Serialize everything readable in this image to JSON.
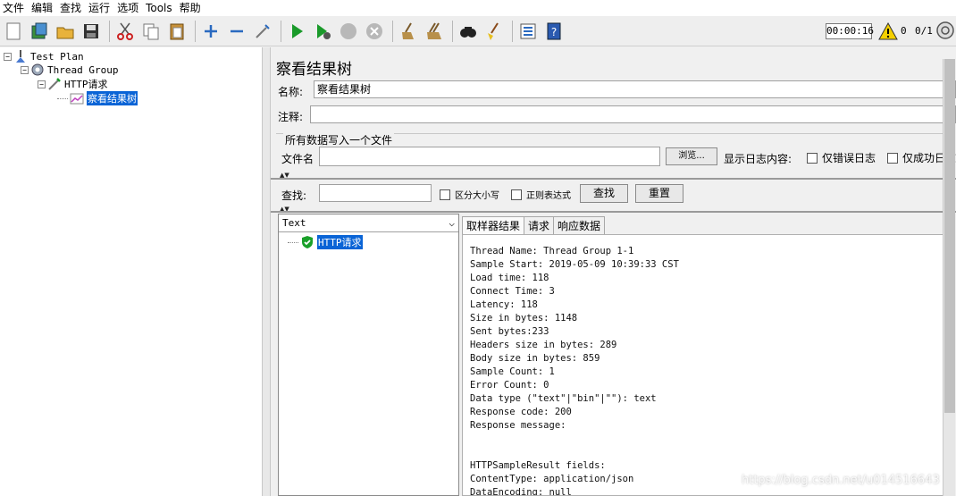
{
  "menu": [
    "文件",
    "编辑",
    "查找",
    "运行",
    "选项",
    "Tools",
    "帮助"
  ],
  "toolbar": {
    "icons": [
      "new-icon",
      "templates-icon",
      "open-icon",
      "save-icon",
      "cut-icon",
      "copy-icon",
      "paste-icon",
      "expand-icon",
      "collapse-icon",
      "toggle-icon",
      "start-icon",
      "start-no-pause-icon",
      "stop-icon",
      "shutdown-icon",
      "clear-icon",
      "clear-all-icon",
      "search-icon",
      "reset-search-icon",
      "function-helper-icon",
      "help-icon"
    ],
    "timer": "00:00:16",
    "error_count": "0",
    "thread_count": "0/1"
  },
  "tree": [
    {
      "label": "Test Plan",
      "selected": false
    },
    {
      "label": "Thread Group",
      "selected": false
    },
    {
      "label": "HTTP请求",
      "selected": false
    },
    {
      "label": "察看结果树",
      "selected": true
    }
  ],
  "panel": {
    "title": "察看结果树",
    "name_label": "名称:",
    "name_value": "察看结果树",
    "comment_label": "注释:",
    "comment_value": "",
    "file_group_title": "所有数据写入一个文件",
    "filename_label": "文件名",
    "filename_value": "",
    "browse_label": "浏览...",
    "log_label": "显示日志内容:",
    "errors_only_label": "仅错误日志",
    "success_only_label": "仅成功日志"
  },
  "search": {
    "label": "查找:",
    "value": "",
    "case_label": "区分大小写",
    "regex_label": "正则表达式",
    "find_label": "查找",
    "reset_label": "重置"
  },
  "results": {
    "renderer": "Text",
    "items": [
      {
        "label": "HTTP请求",
        "status": "success"
      }
    ],
    "tabs": [
      "取样器结果",
      "请求",
      "响应数据"
    ],
    "active_tab": 0,
    "detail_text": "Thread Name: Thread Group 1-1\nSample Start: 2019-05-09 10:39:33 CST\nLoad time: 118\nConnect Time: 3\nLatency: 118\nSize in bytes: 1148\nSent bytes:233\nHeaders size in bytes: 289\nBody size in bytes: 859\nSample Count: 1\nError Count: 0\nData type (\"text\"|\"bin\"|\"\"): text\nResponse code: 200\nResponse message: \n\n\nHTTPSampleResult fields:\nContentType: application/json\nDataEncoding: null"
  },
  "watermark": "https://blog.csdn.net/u014516643"
}
